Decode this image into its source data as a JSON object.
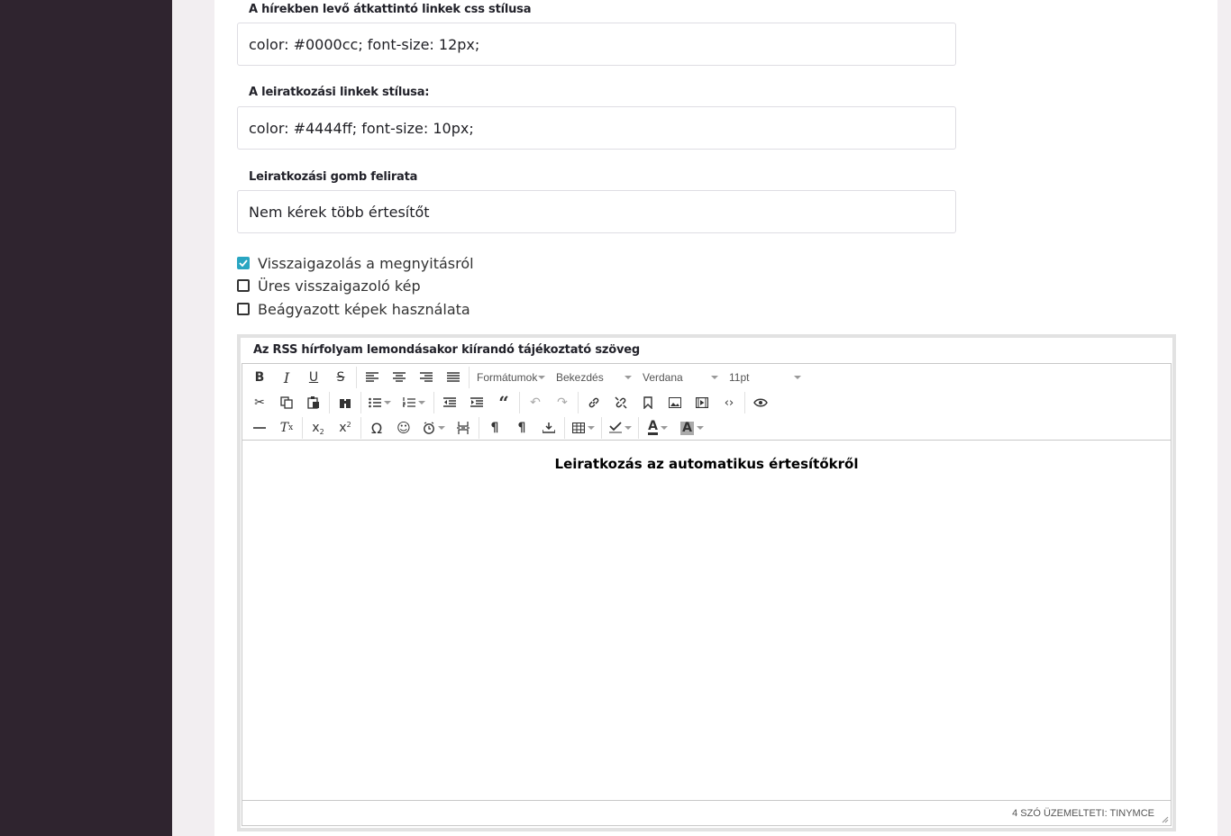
{
  "fields": [
    {
      "label": "A hírekben levő átkattintó linkek css stílusa",
      "value": "color: #0000cc; font-size: 12px;"
    },
    {
      "label": "A leiratkozási linkek stílusa:",
      "value": "color: #4444ff; font-size: 10px;"
    },
    {
      "label": "Leiratkozási gomb felirata",
      "value": "Nem kérek több értesítőt"
    }
  ],
  "checkboxes": [
    {
      "label": "Visszaigazolás a megnyitásról",
      "checked": true
    },
    {
      "label": "Üres visszaigazoló kép",
      "checked": false
    },
    {
      "label": "Beágyazott képek használata",
      "checked": false
    }
  ],
  "editor": {
    "label": "Az RSS hírfolyam lemondásakor kiírandó tájékoztató szöveg",
    "dropdowns": {
      "formats": "Formátumok",
      "block": "Bekezdés",
      "font": "Verdana",
      "size": "11pt"
    },
    "content_heading": "Leiratkozás az automatikus értesítőkről",
    "status": "4 SZÓ ÜZEMELTETI: TINYMCE"
  },
  "colors": {
    "sidebar": "#2f242f",
    "accent": "#29a6c2",
    "page_bg": "#f2eef1"
  }
}
